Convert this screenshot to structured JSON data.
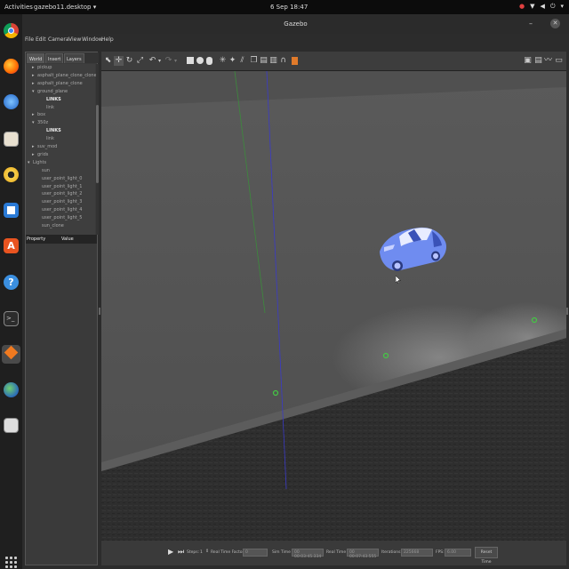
{
  "topbar": {
    "activities": "Activities",
    "app_name": "gazebo11.desktop ▾",
    "clock": "6 Sep 18:47"
  },
  "window": {
    "title": "Gazebo"
  },
  "menu": [
    "File",
    "Edit",
    "Camera",
    "View",
    "Window",
    "Help"
  ],
  "side_panel": {
    "tabs": [
      "World",
      "Insert",
      "Layers"
    ],
    "tree": [
      {
        "label": "pickup",
        "arrow": "▸",
        "indent": 1,
        "bold": false
      },
      {
        "label": "asphalt_plane_clone_clone",
        "arrow": "▸",
        "indent": 1,
        "bold": false
      },
      {
        "label": "asphalt_plane_clone",
        "arrow": "▸",
        "indent": 1,
        "bold": false
      },
      {
        "label": "ground_plane",
        "arrow": "▾",
        "indent": 1,
        "bold": false
      },
      {
        "label": "LINKS",
        "arrow": "",
        "indent": 3,
        "bold": true
      },
      {
        "label": "link",
        "arrow": "",
        "indent": 3,
        "bold": false
      },
      {
        "label": "box",
        "arrow": "▸",
        "indent": 1,
        "bold": false
      },
      {
        "label": "350z",
        "arrow": "▾",
        "indent": 1,
        "bold": false
      },
      {
        "label": "LINKS",
        "arrow": "",
        "indent": 3,
        "bold": true
      },
      {
        "label": "link",
        "arrow": "",
        "indent": 3,
        "bold": false
      },
      {
        "label": "suv_mod",
        "arrow": "▸",
        "indent": 1,
        "bold": false
      },
      {
        "label": "grids",
        "arrow": "▸",
        "indent": 1,
        "bold": false
      },
      {
        "label": "Lights",
        "arrow": "▾",
        "indent": 0,
        "bold": false
      },
      {
        "label": "sun",
        "arrow": "",
        "indent": 2,
        "bold": false
      },
      {
        "label": "user_point_light_0",
        "arrow": "",
        "indent": 2,
        "bold": false
      },
      {
        "label": "user_point_light_1",
        "arrow": "",
        "indent": 2,
        "bold": false
      },
      {
        "label": "user_point_light_2",
        "arrow": "",
        "indent": 2,
        "bold": false
      },
      {
        "label": "user_point_light_3",
        "arrow": "",
        "indent": 2,
        "bold": false
      },
      {
        "label": "user_point_light_4",
        "arrow": "",
        "indent": 2,
        "bold": false
      },
      {
        "label": "user_point_light_5",
        "arrow": "",
        "indent": 2,
        "bold": false
      },
      {
        "label": "sun_clone",
        "arrow": "",
        "indent": 2,
        "bold": false
      }
    ],
    "property_header": {
      "property": "Property",
      "value": "Value"
    }
  },
  "bottom_bar": {
    "steps_label": "Steps:",
    "steps_value": "1",
    "real_time_factor_label": "Real Time Factor:",
    "real_time_factor_value": "0",
    "sim_time_label": "Sim Time",
    "sim_time_value": "00 00:03:45.334",
    "real_time_label": "Real Time",
    "real_time_value": "00 00:07:43.555",
    "iterations_label": "Iterations:",
    "iterations_value": "225668",
    "fps_label": "FPS:",
    "fps_value": "6.00",
    "reset_label": "Reset Time"
  },
  "colors": {
    "background_dark": "#1e1e1e",
    "panel": "#3a3a3a",
    "car_blue": "#6f8cf0",
    "light_marker": "#44c844",
    "orange_accent": "#e07a2a"
  }
}
